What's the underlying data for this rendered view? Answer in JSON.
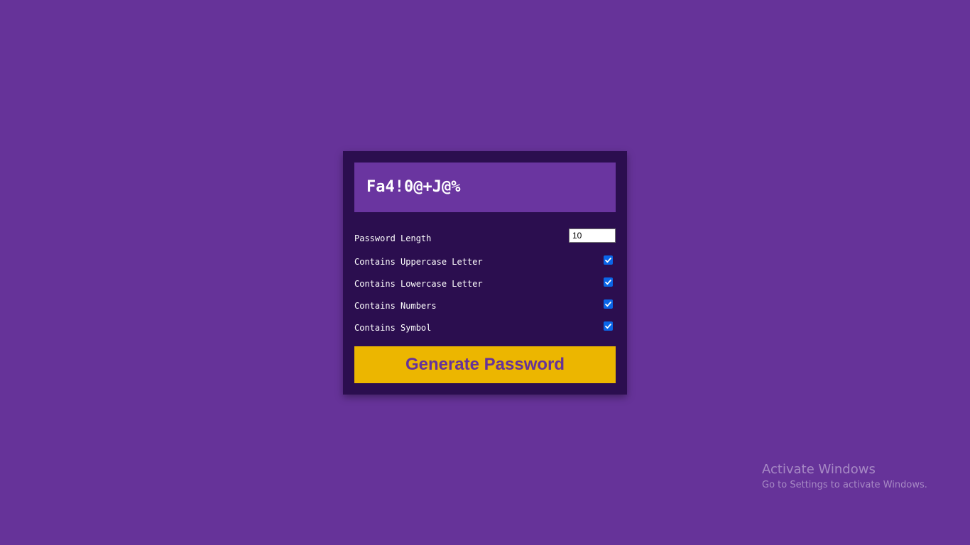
{
  "generator": {
    "result_text": "Fa4!0@+J@%",
    "settings": {
      "length_label": "Password Length",
      "length_value": "10",
      "uppercase_label": "Contains Uppercase Letter",
      "uppercase_checked": true,
      "lowercase_label": "Contains Lowercase Letter",
      "lowercase_checked": true,
      "numbers_label": "Contains Numbers",
      "numbers_checked": true,
      "symbol_label": "Contains Symbol",
      "symbol_checked": true
    },
    "generate_label": "Generate Password"
  },
  "watermark": {
    "title": "Activate Windows",
    "subtitle": "Go to Settings to activate Windows."
  },
  "colors": {
    "page_background": "#663399",
    "card_background": "#2b0e4f",
    "result_background": "#6a35a0",
    "button_background": "#ecb600",
    "button_text": "#663399",
    "checkbox": "#0a66e8"
  }
}
